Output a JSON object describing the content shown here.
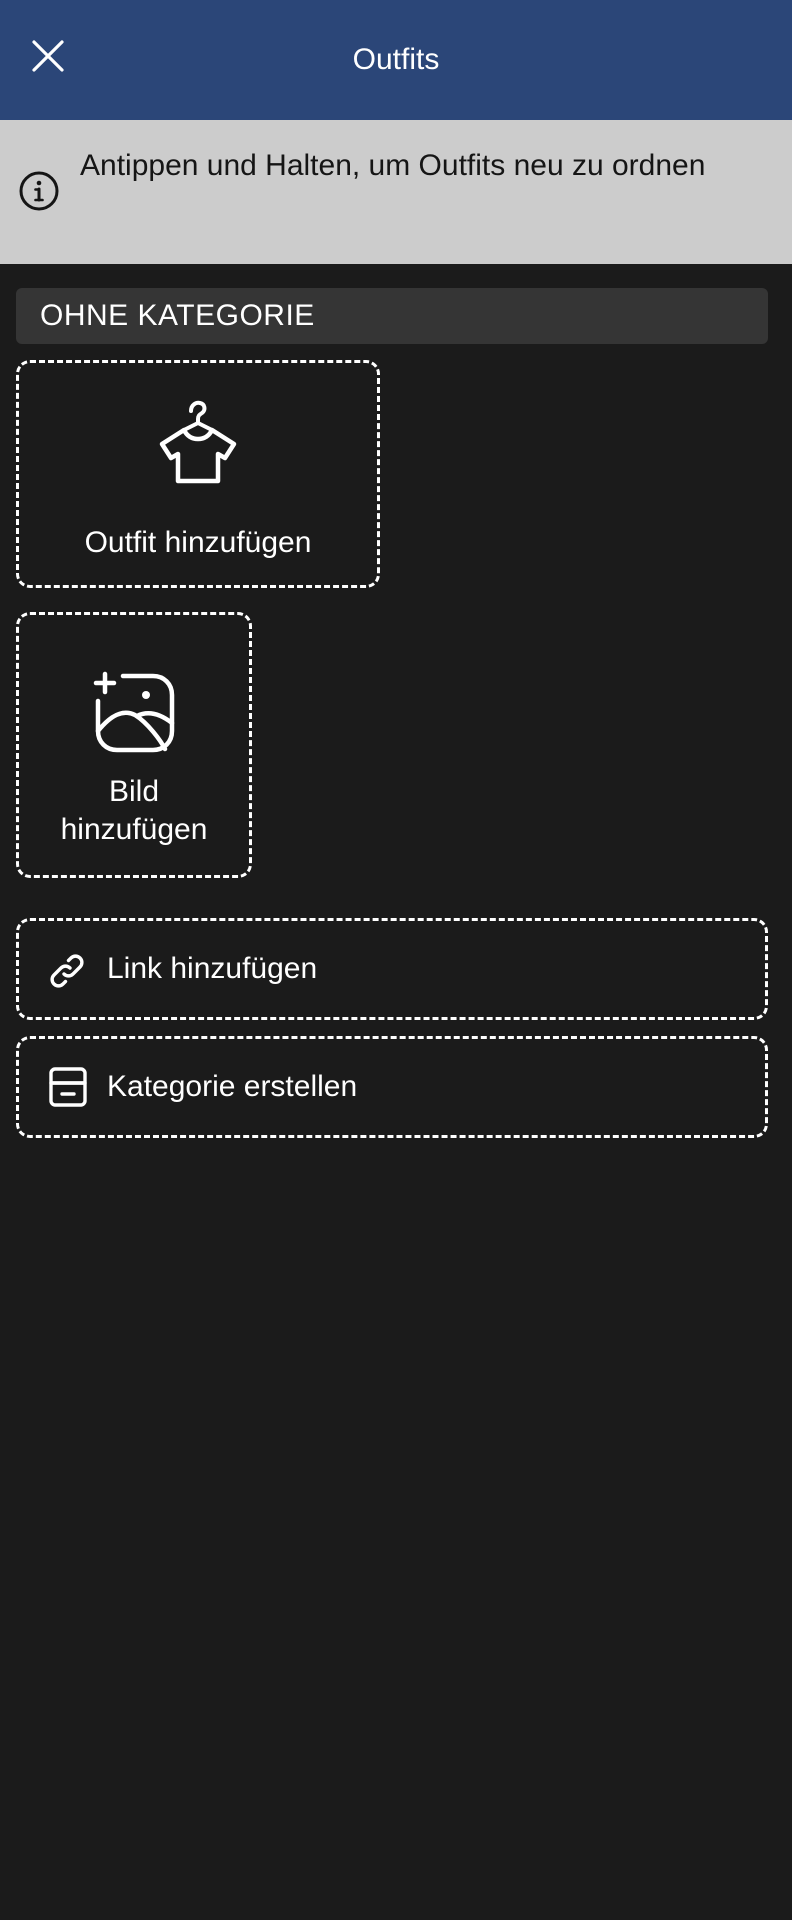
{
  "header": {
    "title": "Outfits",
    "close_icon": "close-icon"
  },
  "info_banner": {
    "icon": "info-icon",
    "text": "Antippen und Halten, um Outfits neu zu ordnen"
  },
  "category": {
    "label": "OHNE KATEGORIE"
  },
  "actions": {
    "add_outfit": {
      "label": "Outfit hinzufügen",
      "icon": "hanger-shirt-icon"
    },
    "add_image": {
      "label": "Bild hinzufügen",
      "icon": "add-image-icon"
    },
    "add_link": {
      "label": "Link hinzufügen",
      "icon": "link-icon"
    },
    "create_category": {
      "label": "Kategorie erstellen",
      "icon": "archive-tray-icon"
    }
  },
  "colors": {
    "header_bg": "#2b4678",
    "banner_bg": "#cccccc",
    "page_bg": "#1b1b1b",
    "category_bg": "#353535"
  }
}
